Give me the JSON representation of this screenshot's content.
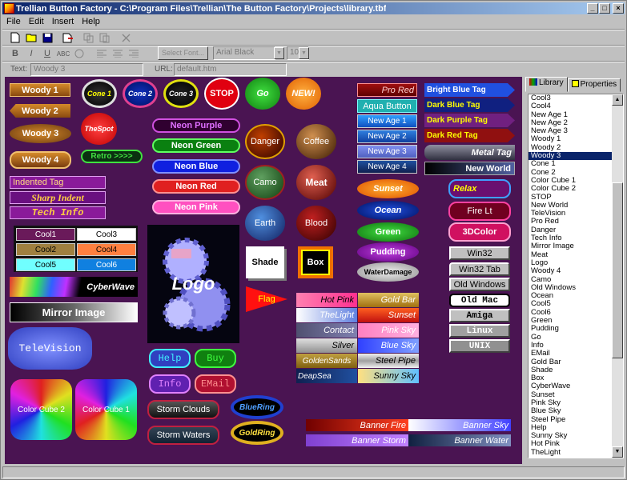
{
  "window": {
    "title": "Trellian Button Factory - C:\\Program Files\\Trellian\\The Button Factory\\Projects\\library.tbf",
    "minimize": "_",
    "maximize": "□",
    "close": "×"
  },
  "menu": [
    "File",
    "Edit",
    "Insert",
    "Help"
  ],
  "format_toolbar": {
    "bold": "B",
    "italic": "I",
    "underline": "U",
    "abc": "ABC",
    "select_font": "Select Font...",
    "font_name": "Arial Black",
    "font_size": "10"
  },
  "text_bar": {
    "text_label": "Text:",
    "text_value": "Woody 3",
    "url_label": "URL:",
    "url_value": "default.htm"
  },
  "panel_tabs": {
    "library": "Library",
    "properties": "Properties"
  },
  "library_items": [
    "Cool3",
    "Cool4",
    "New Age 1",
    "New Age 2",
    "New Age 3",
    "Woody 1",
    "Woody 2",
    "Woody 3",
    "Cone 1",
    "Cone 2",
    "Color Cube 1",
    "Color Cube 2",
    "STOP",
    "New World",
    "TeleVision",
    "Pro Red",
    "Danger",
    "Tech Info",
    "Mirror Image",
    "Meat",
    "Logo",
    "Woody 4",
    "Camo",
    "Old Windows",
    "Ocean",
    "Cool5",
    "Cool6",
    "Green",
    "Pudding",
    "Go",
    "Info",
    "EMail",
    "Gold Bar",
    "Shade",
    "Box",
    "CyberWave",
    "Sunset",
    "Pink Sky",
    "Blue Sky",
    "Steel Pipe",
    "Help",
    "Sunny Sky",
    "Hot Pink",
    "TheLight"
  ],
  "selected_library_item": "Woody 3",
  "canvas_buttons": {
    "woody1": "Woody 1",
    "woody2": "Woody 2",
    "woody3": "Woody 3",
    "woody4": "Woody 4",
    "cone1": "Cone 1",
    "cone2": "Cone 2",
    "cone3": "Cone 3",
    "stop": "STOP",
    "go": "Go",
    "new": "NEW!",
    "thespot": "TheSpot",
    "retro": "Retro >>>>",
    "neon_purple": "Neon Purple",
    "neon_green": "Neon Green",
    "neon_blue": "Neon Blue",
    "neon_red": "Neon Red",
    "neon_pink": "Neon Pink",
    "danger": "Danger",
    "coffee": "Coffee",
    "camo": "Camo",
    "meat": "Meat",
    "earth": "Earth",
    "blood": "Blood",
    "indented": "Indented Tag",
    "sharp": "Sharp Indent",
    "tech": "Tech Info",
    "cool1": "Cool1",
    "cool2": "Cool2",
    "cool3": "Cool3",
    "cool4": "Cool4",
    "cool5": "Cool5",
    "cool6": "Cool6",
    "cyberwave": "CyberWave",
    "mirror": "Mirror Image",
    "television": "TeleVision",
    "logo": "Logo",
    "shade": "Shade",
    "box": "Box",
    "flag": "Flag",
    "colorcube2": "Color Cube 2",
    "colorcube1": "Color Cube 1",
    "help": "Help",
    "buy": "Buy",
    "info": "Info",
    "email": "EMail",
    "storm_clouds": "Storm Clouds",
    "storm_waters": "Storm Waters",
    "bluering": "BlueRing",
    "goldring": "GoldRing",
    "pro_red": "Pro Red",
    "aqua": "Aqua Button",
    "newage1": "New Age 1",
    "newage2": "New Age 2",
    "newage3": "New Age 3",
    "newage4": "New Age 4",
    "sunset": "Sunset",
    "ocean": "Ocean",
    "green": "Green",
    "pudding": "Pudding",
    "waterdamage": "WaterDamage",
    "bright_blue_tag": "Bright Blue Tag",
    "dark_blue_tag": "Dark Blue Tag",
    "dark_purple_tag": "Dark Purple Tag",
    "dark_red_tag": "Dark Red Tag",
    "metal_tag": "Metal Tag",
    "new_world": "New World",
    "relax": "Relax",
    "fire_lt": "Fire Lt",
    "color3d": "3DColor",
    "win32": "Win32",
    "win32tab": "Win32 Tab",
    "old_windows": "Old Windows",
    "old_mac": "Old Mac",
    "amiga": "Amiga",
    "linux": "Linux",
    "unix": "UNIX",
    "hot_pink": "Hot Pink",
    "gold_bar": "Gold Bar",
    "thelight": "TheLight",
    "sunset2": "Sunset",
    "contact": "Contact",
    "pink_sky": "Pink Sky",
    "silver": "Silver",
    "blue_sky": "Blue Sky",
    "goldensands": "GoldenSands",
    "steel_pipe": "Steel Pipe",
    "deapsea": "DeapSea",
    "sunny_sky": "Sunny Sky",
    "banner_fire": "Banner Fire",
    "banner_sky": "Banner Sky",
    "banner_storm": "Banner Storm",
    "banner_water": "Banner Water"
  }
}
